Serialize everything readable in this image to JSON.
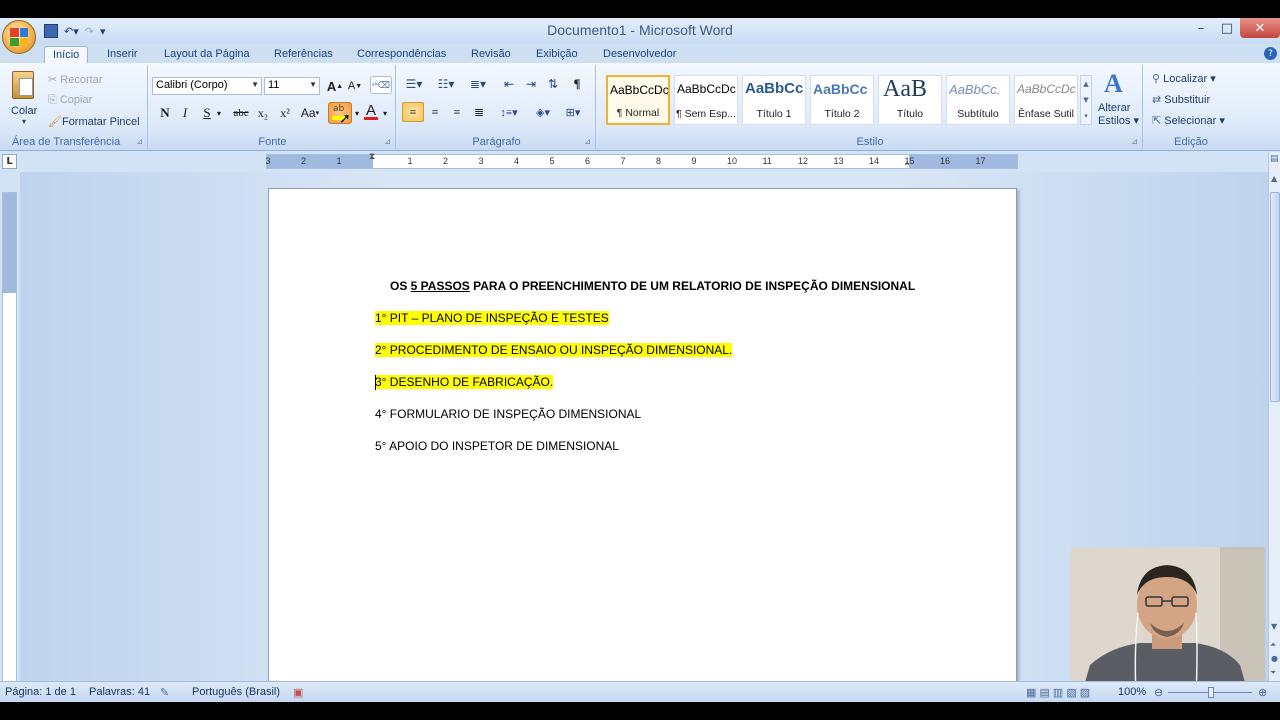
{
  "window": {
    "title": "Documento1 - Microsoft Word",
    "controls": {
      "minimize": "–",
      "maximize": "□",
      "close": "✕"
    }
  },
  "qat": {
    "save_icon": "save-icon",
    "undo_icon": "undo-icon",
    "redo_icon": "redo-icon"
  },
  "tabs": [
    "Início",
    "Inserir",
    "Layout da Página",
    "Referências",
    "Correspondências",
    "Revisão",
    "Exibição",
    "Desenvolvedor"
  ],
  "clipboard": {
    "paste": "Colar",
    "cut": "Recortar",
    "copy": "Copiar",
    "format_painter": "Formatar Pincel",
    "label": "Área de Transferência"
  },
  "font": {
    "name": "Calibri (Corpo)",
    "size": "11",
    "bold": "N",
    "italic": "I",
    "underline": "S",
    "strike": "abc",
    "subscript": "x₂",
    "superscript": "x²",
    "case": "Aa",
    "grow": "A",
    "shrink": "A",
    "font_color_letter": "A",
    "label": "Fonte"
  },
  "paragraph": {
    "label": "Parágrafo"
  },
  "styles": {
    "items": [
      {
        "preview": "AaBbCcDc",
        "name": "¶ Normal"
      },
      {
        "preview": "AaBbCcDc",
        "name": "¶ Sem Esp..."
      },
      {
        "preview": "AaBbCc",
        "name": "Título 1"
      },
      {
        "preview": "AaBbCc",
        "name": "Título 2"
      },
      {
        "preview": "AaB",
        "name": "Título"
      },
      {
        "preview": "AaBbCc.",
        "name": "Subtítulo"
      },
      {
        "preview": "AaBbCcDc",
        "name": "Ênfase Sutil"
      }
    ],
    "change": "Alterar",
    "change2": "Estilos",
    "label": "Estilo"
  },
  "editing": {
    "find": "Localizar",
    "replace": "Substituir",
    "select": "Selecionar",
    "label": "Edição"
  },
  "ruler": {
    "numbers": [
      "3",
      "2",
      "1",
      "1",
      "2",
      "3",
      "4",
      "5",
      "6",
      "7",
      "8",
      "9",
      "10",
      "11",
      "12",
      "13",
      "14",
      "15",
      "16",
      "17"
    ]
  },
  "document": {
    "title_pre": "OS ",
    "title_underlined": "5 PASSOS",
    "title_post": " PARA O PREENCHIMENTO DE UM RELATORIO DE INSPEÇÃO DIMENSIONAL",
    "lines": [
      "1° PIT – PLANO DE INSPEÇÃO E TESTES",
      "2° PROCEDIMENTO DE ENSAIO OU INSPEÇÃO DIMENSIONAL.",
      "3° DESENHO DE FABRICAÇÃO.",
      "4° FORMULARIO DE INSPEÇÃO DIMENSIONAL",
      "5° APOIO DO INSPETOR DE DIMENSIONAL"
    ],
    "highlighted": [
      true,
      true,
      true,
      false,
      false
    ]
  },
  "status": {
    "page": "Página: 1 de 1",
    "words": "Palavras: 41",
    "language": "Português (Brasil)",
    "zoom": "100%"
  },
  "colors": {
    "highlight": "#ffff00",
    "ribbon_blue": "#15428b",
    "font_color": "#e11b1b"
  }
}
